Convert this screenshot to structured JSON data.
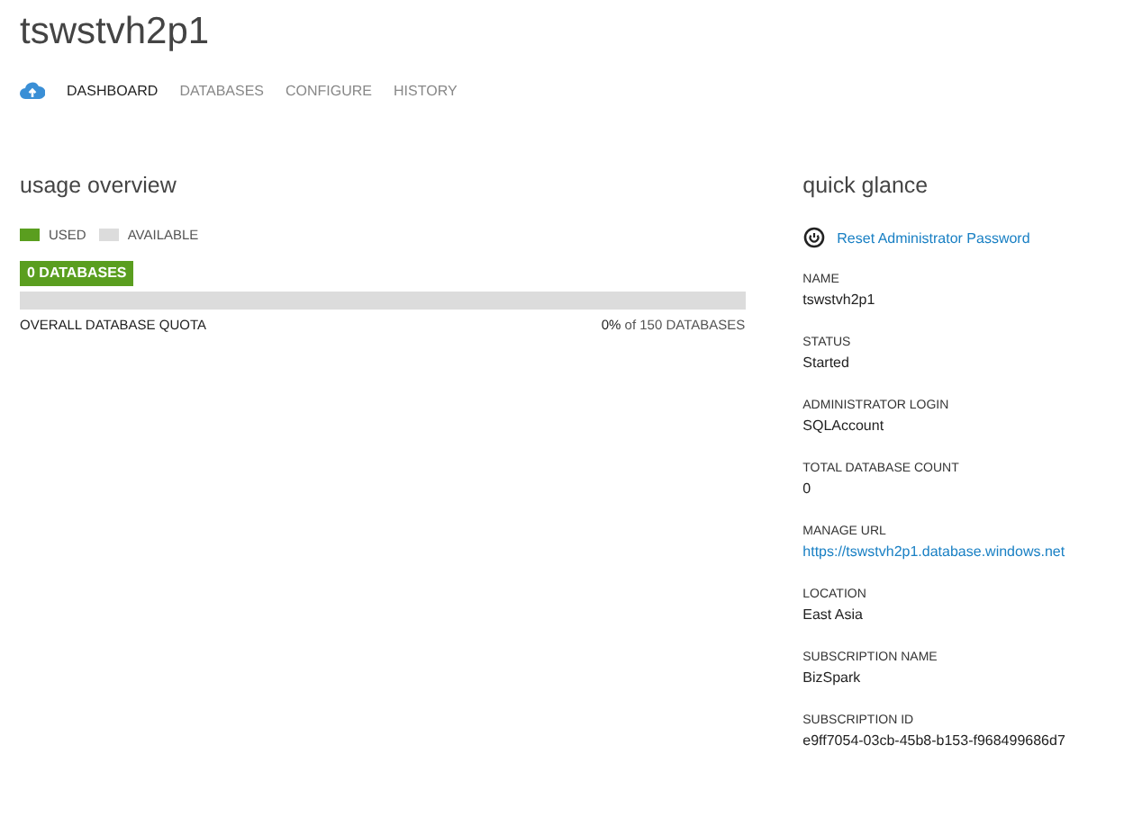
{
  "title": "tswstvh2p1",
  "tabs": [
    {
      "label": "DASHBOARD",
      "selected": true
    },
    {
      "label": "DATABASES",
      "selected": false
    },
    {
      "label": "CONFIGURE",
      "selected": false
    },
    {
      "label": "HISTORY",
      "selected": false
    }
  ],
  "usage_overview": {
    "heading": "usage overview",
    "legend": [
      {
        "label": "USED",
        "color": "#5a9e1f"
      },
      {
        "label": "AVAILABLE",
        "color": "#dcdcdc"
      }
    ],
    "badge": "0 DATABASES",
    "level": 0,
    "quota_label": "OVERALL DATABASE QUOTA",
    "quota_reading": "**0%** of 150 DATABASES"
  },
  "quick_glance": {
    "heading": "quick glance",
    "action": "Reset Administrator Password",
    "fields": [
      {
        "label": "NAME",
        "value": "tswstvh2p1"
      },
      {
        "label": "STATUS",
        "value": "Started"
      },
      {
        "label": "ADMINISTRATOR LOGIN",
        "value": "SQLAccount"
      },
      {
        "label": "TOTAL DATABASE COUNT",
        "value": "0"
      },
      {
        "label": "MANAGE URL",
        "link": "https://tswstvh2p1.database.windows.net"
      },
      {
        "label": "LOCATION",
        "value": "East Asia"
      },
      {
        "label": "SUBSCRIPTION NAME",
        "value": "BizSpark"
      },
      {
        "label": "SUBSCRIPTION ID",
        "value": "e9ff7054-03cb-45b8-b153-f968499686d7"
      }
    ]
  }
}
